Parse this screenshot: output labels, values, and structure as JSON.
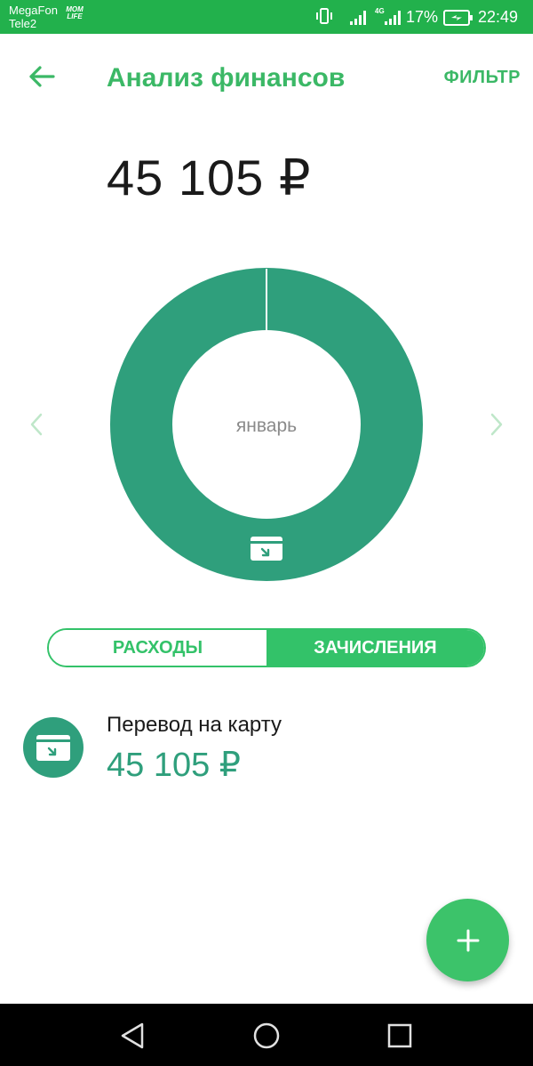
{
  "status_bar": {
    "carrier_1": "MegaFon",
    "carrier_2": "Tele2",
    "app_badge_line1": "MOM",
    "app_badge_line2": "LIFE",
    "network_type": "4G",
    "battery_percent": "17%",
    "time": "22:49"
  },
  "header": {
    "title": "Анализ финансов",
    "filter_label": "ФИЛЬТР",
    "back_icon": "arrow-left-icon"
  },
  "total": "45 105 ₽",
  "chart_data": {
    "type": "pie",
    "month": "январь",
    "categories": [
      "Перевод на карту"
    ],
    "values": [
      45105
    ],
    "colors": [
      "#2f9f7c"
    ]
  },
  "toggle": {
    "expenses_label": "РАСХОДЫ",
    "income_label": "ЗАЧИСЛЕНИЯ",
    "selected": "income"
  },
  "items": [
    {
      "title": "Перевод на карту",
      "amount": "45 105 ₽",
      "icon": "card-transfer-icon"
    }
  ],
  "colors": {
    "brand": "#22b14c",
    "accent": "#3bb866",
    "chart": "#2f9f7c"
  }
}
